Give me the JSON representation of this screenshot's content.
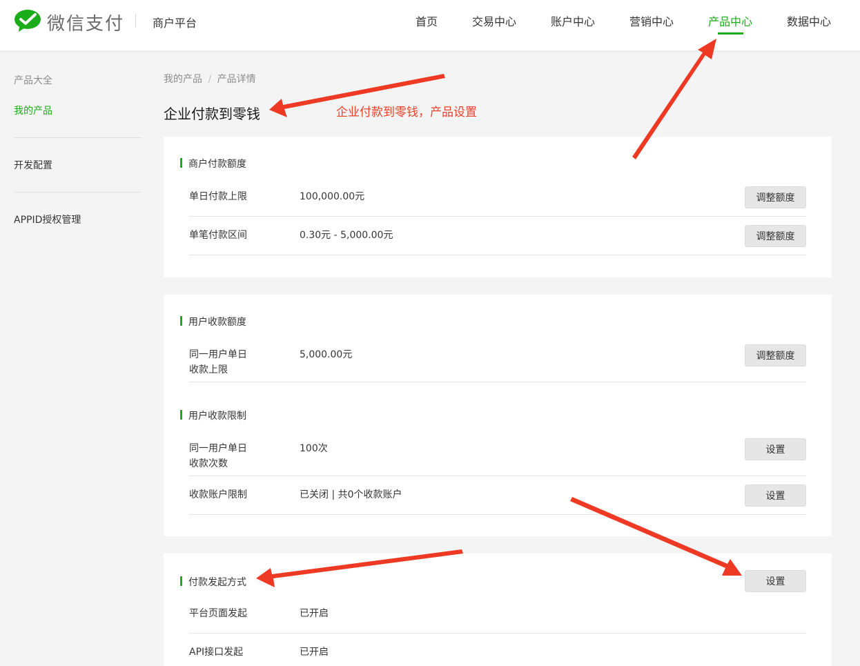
{
  "header": {
    "brand": "微信支付",
    "platform": "商户平台",
    "nav": [
      "首页",
      "交易中心",
      "账户中心",
      "营销中心",
      "产品中心",
      "数据中心"
    ],
    "active_nav": "产品中心"
  },
  "sidebar": {
    "items": [
      "产品大全",
      "我的产品",
      "开发配置",
      "APPID授权管理"
    ]
  },
  "breadcrumb": {
    "parent": "我的产品",
    "sep": "/",
    "current": "产品详情"
  },
  "page_title": "企业付款到零钱",
  "annotation": "企业付款到零钱，产品设置",
  "card1": {
    "title": "商户付款额度",
    "rows": [
      {
        "label": "单日付款上限",
        "value": "100,000.00元",
        "button": "调整额度"
      },
      {
        "label": "单笔付款区间",
        "value": "0.30元 - 5,000.00元",
        "button": "调整额度"
      }
    ]
  },
  "card2": {
    "section1_title": "用户收款额度",
    "row1": {
      "label_line1": "同一用户单日",
      "label_line2": "收款上限",
      "value": "5,000.00元",
      "button": "调整额度"
    },
    "section2_title": "用户收款限制",
    "row2": {
      "label_line1": "同一用户单日",
      "label_line2": "收款次数",
      "value": "100次",
      "button": "设置"
    },
    "row3": {
      "label": "收款账户限制",
      "value": "已关闭 | 共0个收款账户",
      "button": "设置"
    }
  },
  "card3": {
    "title": "付款发起方式",
    "button": "设置",
    "rows": [
      {
        "label": "平台页面发起",
        "value": "已开启"
      },
      {
        "label": "API接口发起",
        "value": "已开启"
      }
    ]
  },
  "colors": {
    "accent": "#1aad19",
    "annotation": "#e8412c"
  }
}
